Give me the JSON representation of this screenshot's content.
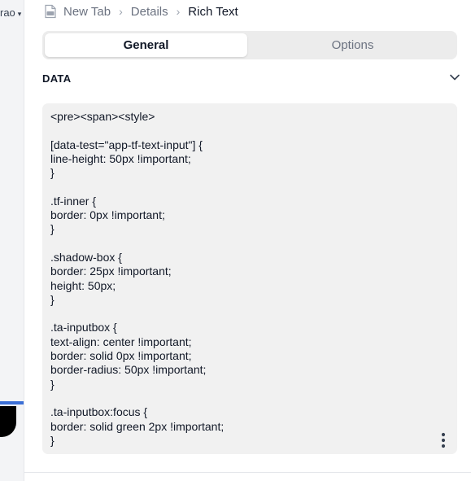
{
  "sidebar": {
    "user_label": "rao",
    "chevron": "▾"
  },
  "breadcrumb": {
    "items": [
      {
        "label": "New Tab",
        "icon": "file-icon"
      },
      {
        "label": "Details"
      },
      {
        "label": "Rich Text"
      }
    ],
    "separator": "›"
  },
  "tabs": [
    {
      "label": "General",
      "active": true
    },
    {
      "label": "Options",
      "active": false
    }
  ],
  "section": {
    "title": "DATA",
    "icon": "chevron-down-icon"
  },
  "editor": {
    "content": "<pre><span><style>\n\n[data-test=\"app-tf-text-input\"] {\nline-height: 50px !important;\n}\n\n.tf-inner {\nborder: 0px !important;\n}\n\n.shadow-box {\nborder: 25px !important;\nheight: 50px;\n}\n\n.ta-inputbox {\ntext-align: center !important;\nborder: solid 0px !important;\nborder-radius: 50px !important;\n}\n\n.ta-inputbox:focus {\nborder: solid green 2px !important;\n}",
    "menu_icon": "more-vertical-icon"
  },
  "colors": {
    "accent": "#3b6fd6",
    "panel_bg": "#ffffff",
    "editor_bg": "#f1f1f1"
  }
}
